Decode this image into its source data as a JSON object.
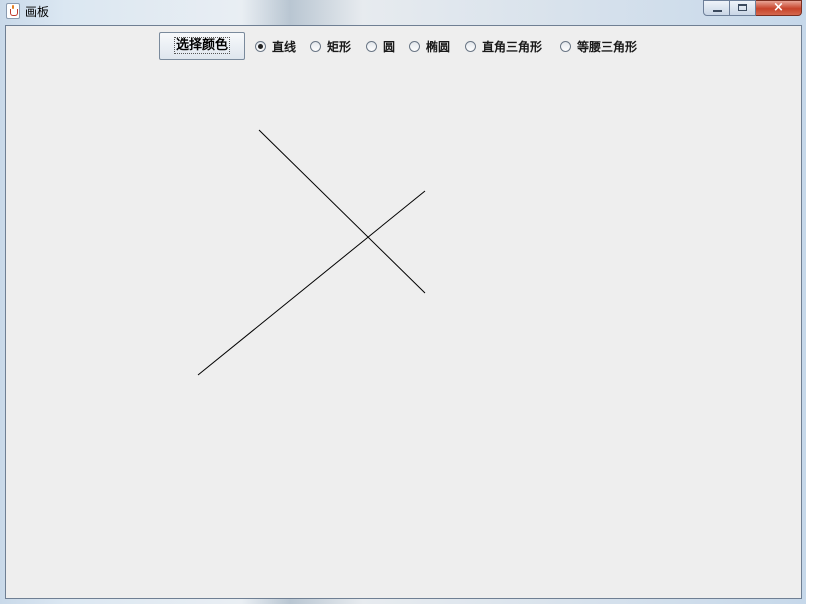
{
  "window": {
    "title": "画板",
    "buttons": {
      "minimize": "minimize",
      "maximize": "maximize",
      "close": "×"
    }
  },
  "toolbar": {
    "color_button_label": "选择颜色",
    "shapes": [
      {
        "label": "直线",
        "checked": true
      },
      {
        "label": "矩形",
        "checked": false
      },
      {
        "label": "圆",
        "checked": false
      },
      {
        "label": "椭圆",
        "checked": false
      },
      {
        "label": "直角三角形",
        "checked": false
      },
      {
        "label": "等腰三角形",
        "checked": false
      }
    ]
  },
  "drawing": {
    "stroke_color": "#000000"
  }
}
